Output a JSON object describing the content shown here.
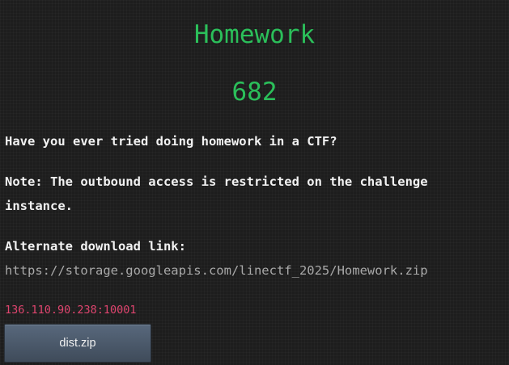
{
  "challenge": {
    "title": "Homework",
    "points": "682",
    "description": [
      "Have you ever tried doing homework in a CTF?",
      "Note: The outbound access is restricted on the challenge instance.",
      "Alternate download link:"
    ],
    "alternate_link": "https://storage.googleapis.com/linectf_2025/Homework.zip",
    "connection": "136.110.90.238:10001",
    "file_button_label": "dist.zip"
  },
  "colors": {
    "background": "#1d1d1d",
    "title": "#2bbf5a",
    "text": "#f2f2f2",
    "link": "#a9a9a9",
    "connection": "#e0456f",
    "button": "#4f5d6e"
  }
}
